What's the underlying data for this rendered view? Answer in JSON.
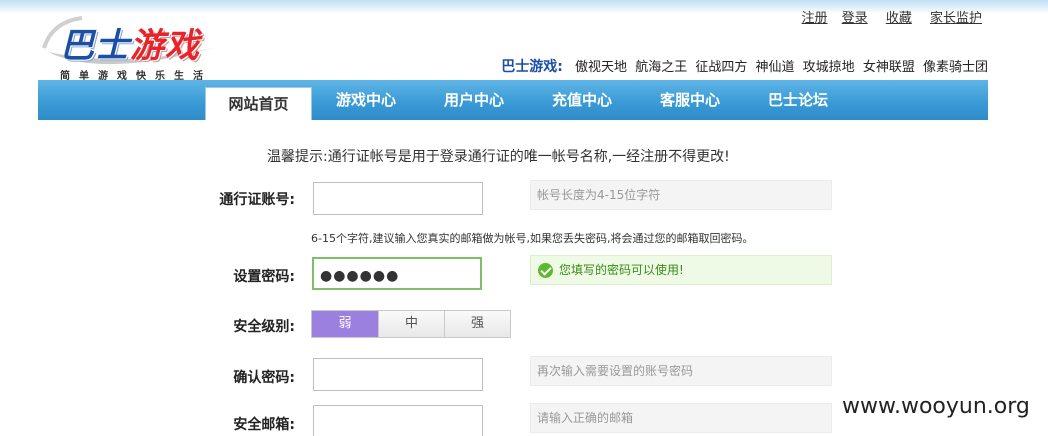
{
  "header": {
    "logo": {
      "part1": "巴士",
      "part2": "游戏",
      "slogan": "简单游戏快乐生活"
    },
    "top_links": [
      "注册",
      "登录",
      "收藏",
      "家长监护"
    ],
    "brand_label": "巴士游戏:",
    "games": [
      "傲视天地",
      "航海之王",
      "征战四方",
      "神仙道",
      "攻城掠地",
      "女神联盟",
      "像素骑士团"
    ]
  },
  "nav": {
    "tabs": [
      {
        "label": "网站首页",
        "active": true
      },
      {
        "label": "游戏中心",
        "active": false
      },
      {
        "label": "用户中心",
        "active": false
      },
      {
        "label": "充值中心",
        "active": false
      },
      {
        "label": "客服中心",
        "active": false
      },
      {
        "label": "巴士论坛",
        "active": false
      }
    ]
  },
  "form": {
    "hint": "温馨提示:通行证帐号是用于登录通行证的唯一帐号名称,一经注册不得更改!",
    "account": {
      "label": "通行证账号:",
      "value": "",
      "tip": "帐号长度为4-15位字符"
    },
    "account_note": "6-15个字符,建议输入您真实的邮箱做为帐号,如果您丢失密码,将会通过您的邮箱取回密码。",
    "password": {
      "label": "设置密码:",
      "masked": "●●●●●●",
      "tip": "您填写的密码可以使用!"
    },
    "strength": {
      "label": "安全级别:",
      "levels": [
        "弱",
        "中",
        "强"
      ],
      "current": "弱"
    },
    "confirm": {
      "label": "确认密码:",
      "value": "",
      "tip": "再次输入需要设置的账号密码"
    },
    "email": {
      "label": "安全邮箱:",
      "value": "",
      "tip": "请输入正确的邮箱"
    }
  },
  "watermark": "www.wooyun.org",
  "colors": {
    "nav_blue": "#3b9bd6",
    "weak_purple": "#9b80e0",
    "success_green": "#3a8a18"
  }
}
